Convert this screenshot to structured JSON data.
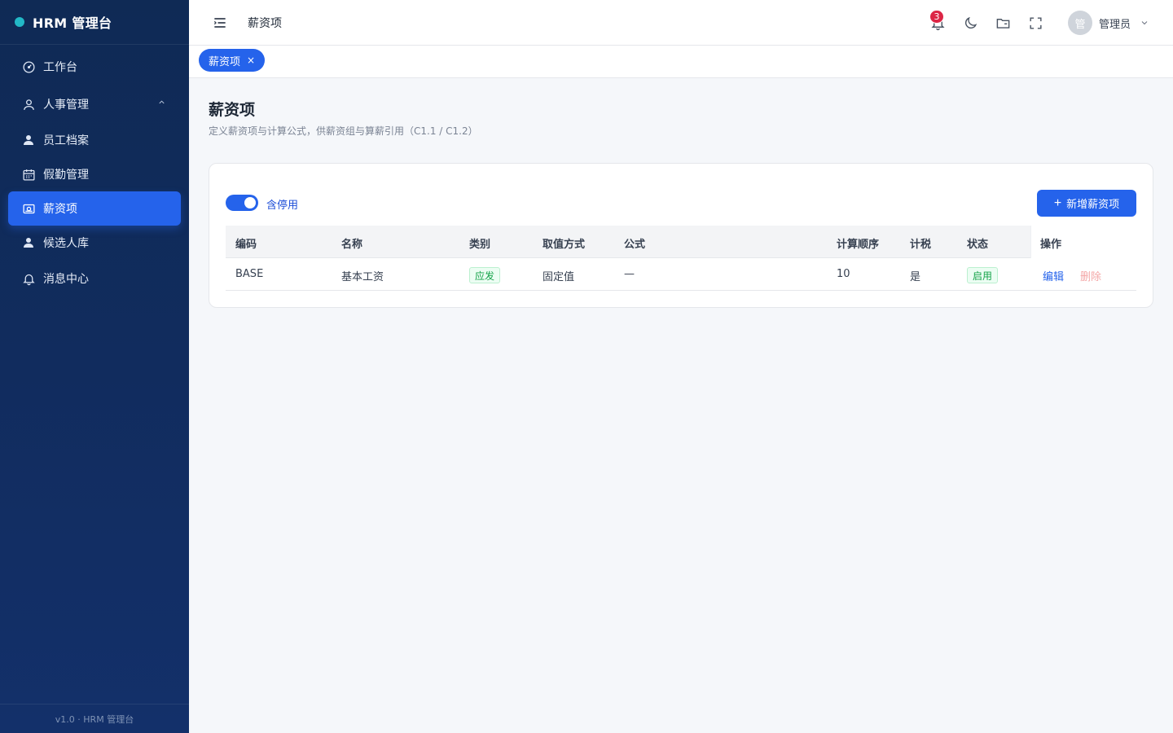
{
  "app": {
    "brand": "HRM 管理台",
    "footer": "v1.0 · HRM 管理台"
  },
  "sidebar": {
    "items": [
      {
        "label": "工作台",
        "icon": "dashboard-gauge-icon"
      },
      {
        "label": "人事管理",
        "icon": "user-outline-icon",
        "expanded": true
      },
      {
        "label": "员工档案",
        "icon": "user-solid-icon"
      },
      {
        "label": "假勤管理",
        "icon": "calendar-icon"
      },
      {
        "label": "薪资项",
        "icon": "money-icon",
        "active": true
      },
      {
        "label": "候选人库",
        "icon": "user-solid-icon"
      },
      {
        "label": "消息中心",
        "icon": "bell-icon"
      }
    ]
  },
  "header": {
    "breadcrumb": "薪资项",
    "notification_count": "3",
    "user": {
      "avatar_text": "管",
      "name": "管理员"
    }
  },
  "tabs": [
    {
      "label": "薪资项",
      "close": "×"
    }
  ],
  "page": {
    "title": "薪资项",
    "subtitle": "定义薪资项与计算公式，供薪资组与算薪引用（C1.1 / C1.2）"
  },
  "toolbar": {
    "include_disabled_label": "含停用",
    "include_disabled": true,
    "add_button": "新增薪资项",
    "add_icon": "+"
  },
  "table": {
    "headers": {
      "code": "编码",
      "name": "名称",
      "category": "类别",
      "value_mode": "取值方式",
      "formula": "公式",
      "order": "计算顺序",
      "taxable": "计税",
      "status": "状态",
      "ops": "操作"
    },
    "rows": [
      {
        "code": "BASE",
        "name": "基本工资",
        "category": "应发",
        "value_mode": "固定值",
        "formula": "—",
        "order": "10",
        "taxable": "是",
        "status": "启用",
        "edit": "编辑",
        "delete": "删除"
      }
    ]
  },
  "colors": {
    "primary": "#2563eb",
    "sidebar": "#112c5e",
    "success": "#16a34a",
    "danger": "#dc2646"
  }
}
